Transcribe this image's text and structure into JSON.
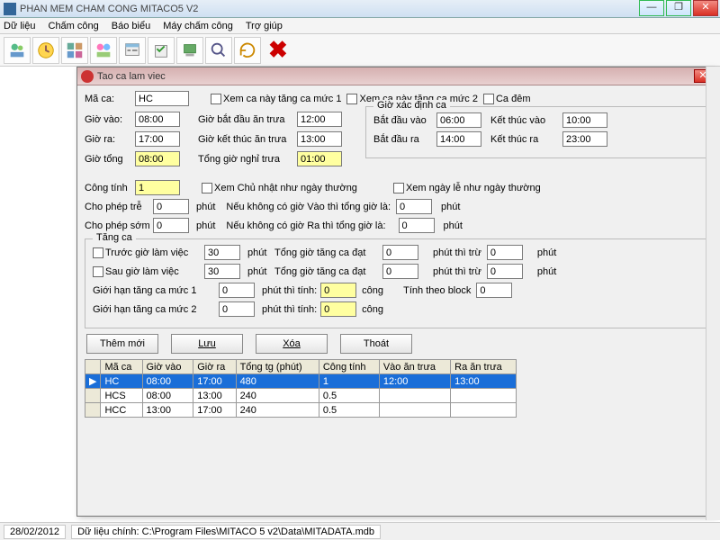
{
  "window": {
    "title": "PHAN MEM CHAM CONG MITACO5 V2"
  },
  "menu": {
    "items": [
      "Dữ liệu",
      "Chấm công",
      "Báo biểu",
      "Máy chấm công",
      "Trợ giúp"
    ]
  },
  "dialog": {
    "title": "Tao ca lam viec"
  },
  "fields": {
    "ma_ca_label": "Mã ca:",
    "ma_ca": "HC",
    "gio_vao_label": "Giờ vào:",
    "gio_vao": "08:00",
    "gio_ra_label": "Giờ ra:",
    "gio_ra": "17:00",
    "gio_tong_label": "Giờ tổng",
    "gio_tong": "08:00",
    "cong_tinh_label": "Công tính",
    "cong_tinh": "1",
    "gio_bd_an_label": "Giờ bắt đầu ăn trưa",
    "gio_bd_an": "12:00",
    "gio_kt_an_label": "Giờ kết thúc ăn trưa",
    "gio_kt_an": "13:00",
    "tong_gio_nghi_label": "Tổng giờ nghỉ trưa",
    "tong_gio_nghi": "01:00",
    "xem_tc1": "Xem ca này tăng ca mức 1",
    "xem_tc2": "Xem ca này tăng ca mức 2",
    "ca_dem": "Ca đêm",
    "xem_cn": "Xem Chủ nhật như ngày thường",
    "xem_le": "Xem ngày lễ như ngày thường",
    "cho_phep_tre_label": "Cho phép trễ",
    "cho_phep_tre": "0",
    "cho_phep_som_label": "Cho phép sớm",
    "cho_phep_som": "0",
    "phut": "phút",
    "khong_vao": "Nếu không có giờ Vào thì tổng giờ là:",
    "khong_vao_v": "0",
    "khong_ra": "Nếu không có giờ Ra thì tổng giờ là:",
    "khong_ra_v": "0"
  },
  "xacdinh": {
    "legend": "Giờ xác định ca",
    "bd_vao_label": "Bắt đầu vào",
    "bd_vao": "06:00",
    "kt_vao_label": "Kết thúc vào",
    "kt_vao": "10:00",
    "bd_ra_label": "Bắt đầu ra",
    "bd_ra": "14:00",
    "kt_ra_label": "Kết thúc ra",
    "kt_ra": "23:00"
  },
  "tangca": {
    "legend": "Tăng ca",
    "truoc_label": "Trước giờ làm việc",
    "truoc": "30",
    "sau_label": "Sau giờ làm việc",
    "sau": "30",
    "phut": "phút",
    "tong_dat_label": "Tổng giờ tăng ca đạt",
    "tong_dat1": "0",
    "tong_dat2": "0",
    "phut_thi_tru": "phút thì trừ",
    "tru1": "0",
    "tru2": "0",
    "gh1_label": "Giới hạn tăng  ca mức 1",
    "gh1": "0",
    "gh2_label": "Giới hạn tăng ca mức 2",
    "gh2": "0",
    "phut_thi_tinh": "phút thì tính:",
    "tinh1": "0",
    "tinh2": "0",
    "cong": "công",
    "block_label": "Tính theo block",
    "block": "0"
  },
  "buttons": {
    "them": "Thêm mới",
    "luu": "Lưu",
    "xoa": "Xóa",
    "thoat": "Thoát"
  },
  "table": {
    "headers": [
      "Mã ca",
      "Giờ vào",
      "Giờ ra",
      "Tổng tg (phút)",
      "Công tính",
      "Vào ăn trưa",
      "Ra ăn trưa"
    ],
    "rows": [
      {
        "sel": true,
        "cells": [
          "HC",
          "08:00",
          "17:00",
          "480",
          "1",
          "12:00",
          "13:00"
        ]
      },
      {
        "sel": false,
        "cells": [
          "HCS",
          "08:00",
          "13:00",
          "240",
          "0.5",
          "",
          ""
        ]
      },
      {
        "sel": false,
        "cells": [
          "HCC",
          "13:00",
          "17:00",
          "240",
          "0.5",
          "",
          ""
        ]
      }
    ]
  },
  "status": {
    "date": "28/02/2012",
    "path": "Dữ liệu chính: C:\\Program Files\\MITACO 5 v2\\Data\\MITADATA.mdb"
  }
}
